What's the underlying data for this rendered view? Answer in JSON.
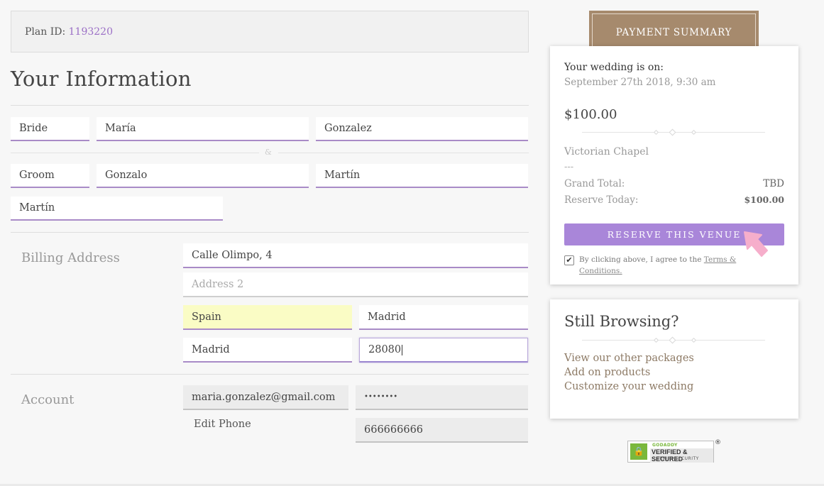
{
  "plan": {
    "label": "Plan ID: ",
    "id": "1193220"
  },
  "page_title": "Your Information",
  "bride": {
    "label": "Bride",
    "first_name": "María",
    "last_name": "Gonzalez"
  },
  "separator": "&",
  "groom": {
    "label": "Groom",
    "first_name": "Gonzalo",
    "last_name": "Martín",
    "second_last_name": "Martín"
  },
  "billing": {
    "label": "Billing Address",
    "address1": "Calle Olimpo, 4",
    "address2_placeholder": "Address 2",
    "country": "Spain",
    "city": "Madrid",
    "state": "Madrid",
    "zip": "28080"
  },
  "account": {
    "label": "Account",
    "email": "maria.gonzalez@gmail.com",
    "password_mask": "••••••••",
    "edit_phone_label": "Edit Phone",
    "phone": "666666666"
  },
  "payment_summary": {
    "tab_title": "PAYMENT SUMMARY",
    "wedding_on_label": "Your wedding is on:",
    "wedding_date": "September 27th 2018, 9:30 am",
    "price": "$100.00",
    "venue": "Victorian Chapel",
    "dashes": "---",
    "grand_total_label": "Grand Total:",
    "grand_total_value": "TBD",
    "reserve_today_label": "Reserve Today:",
    "reserve_today_value": "$100.00",
    "reserve_button": "RESERVE THIS VENUE",
    "terms_prefix": "By clicking above, I agree to the ",
    "terms_link": "Terms & Conditions."
  },
  "still_browsing": {
    "title": "Still Browsing?",
    "links": [
      "View our other packages",
      "Add on products",
      "Customize your wedding"
    ]
  },
  "godaddy": {
    "top": "GODADDY",
    "mid": "VERIFIED & SECURED",
    "bottom": "VERIFY SECURITY",
    "reg": "®"
  },
  "colors": {
    "accent_purple": "#a986d9",
    "brand_brown": "#a68a6d",
    "link_brown": "#8d7a65",
    "autofill_yellow": "#fafcc5"
  },
  "icons": [
    "checkmark-icon",
    "pointer-arrow-icon",
    "shield-lock-icon"
  ]
}
